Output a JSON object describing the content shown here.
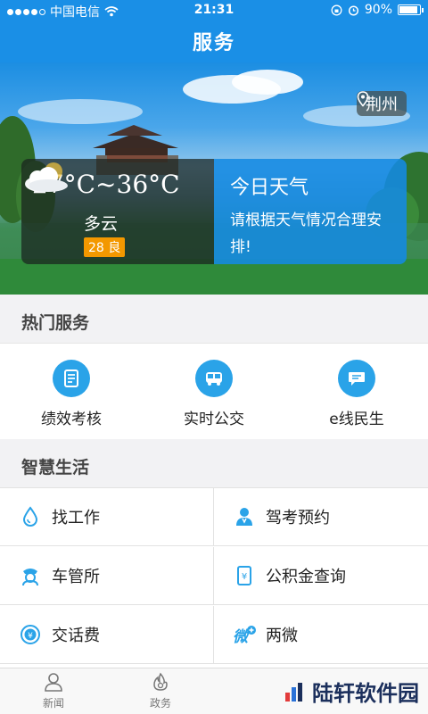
{
  "status": {
    "carrier": "中国电信",
    "time": "21:31",
    "battery": "90%",
    "signal_bars": 4,
    "battery_level": 0.9
  },
  "header": {
    "title": "服务"
  },
  "weather": {
    "location": "荆州",
    "temperature": "27°C~36°C",
    "condition": "多云",
    "aqi": "28 良",
    "panel_title": "今日天气",
    "panel_text": "请根据天气情况合理安排!"
  },
  "hot_services": {
    "heading": "热门服务",
    "items": [
      {
        "label": "绩效考核",
        "icon": "document-icon"
      },
      {
        "label": "实时公交",
        "icon": "bus-icon"
      },
      {
        "label": "e线民生",
        "icon": "chat-icon"
      }
    ]
  },
  "smart_life": {
    "heading": "智慧生活",
    "items": [
      {
        "label": "找工作",
        "icon": "drop-icon"
      },
      {
        "label": "驾考预约",
        "icon": "person-icon"
      },
      {
        "label": "车管所",
        "icon": "police-icon"
      },
      {
        "label": "公积金查询",
        "icon": "phone-card-icon"
      },
      {
        "label": "交话费",
        "icon": "yen-coin-icon"
      },
      {
        "label": "两微",
        "icon": "weibo-plus-icon"
      }
    ]
  },
  "bottom_nav": [
    {
      "label": "新闻",
      "icon": "person-outline-icon"
    },
    {
      "label": "政务",
      "icon": "flame-icon"
    }
  ],
  "watermark": "陆轩软件园",
  "colors": {
    "brand": "#1a8fe6",
    "accent_orange": "#f39800",
    "icon_blue": "#2aa3e8"
  }
}
